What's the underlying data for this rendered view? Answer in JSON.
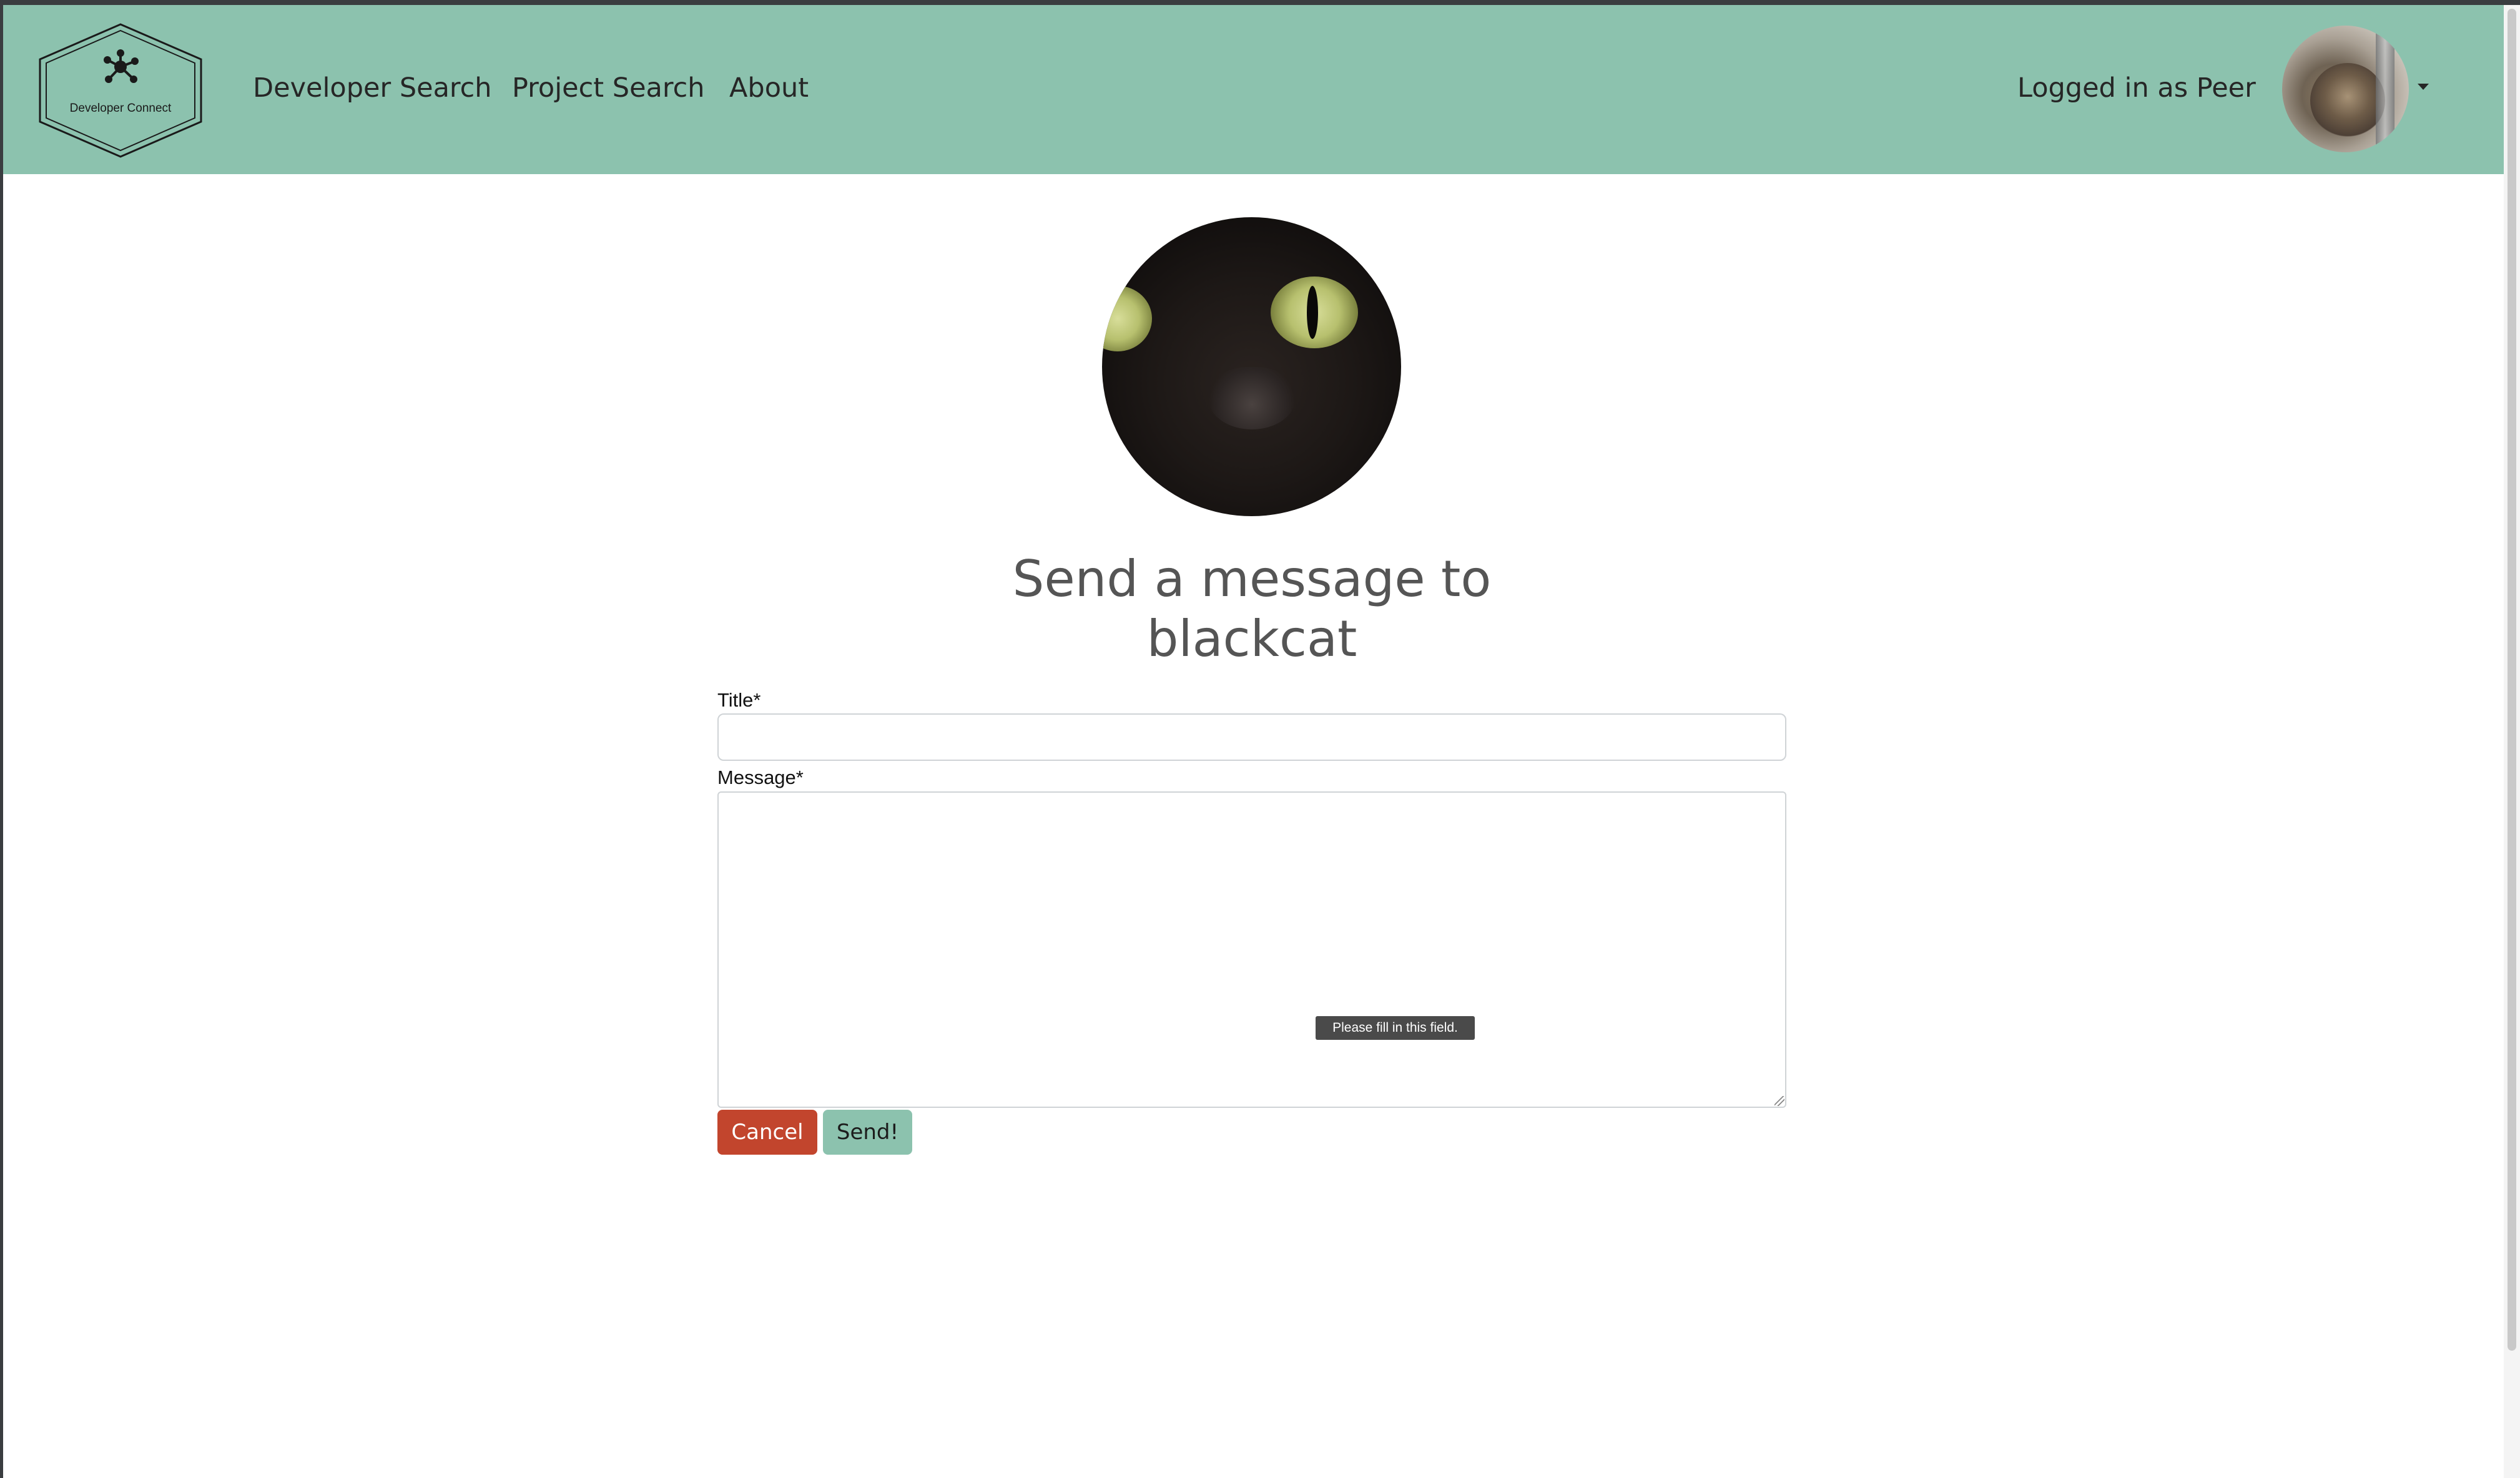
{
  "navbar": {
    "logo_text": "Developer Connect",
    "links": [
      "Developer Search",
      "Project Search",
      "About"
    ],
    "logged_in_text": "Logged in as Peer"
  },
  "main": {
    "heading_line1": "Send a message to",
    "heading_line2": "blackcat",
    "title_label": "Title*",
    "message_label": "Message*",
    "validation_tooltip": "Please fill in this field.",
    "cancel_label": "Cancel",
    "send_label": "Send!"
  },
  "colors": {
    "navbar_bg": "#8cc2ae",
    "cancel_bg": "#c2452d",
    "send_bg": "#8cc2ae",
    "heading_text": "#555555"
  },
  "icons": {
    "logo": "network-hexagon-icon",
    "dropdown": "caret-down-icon"
  }
}
